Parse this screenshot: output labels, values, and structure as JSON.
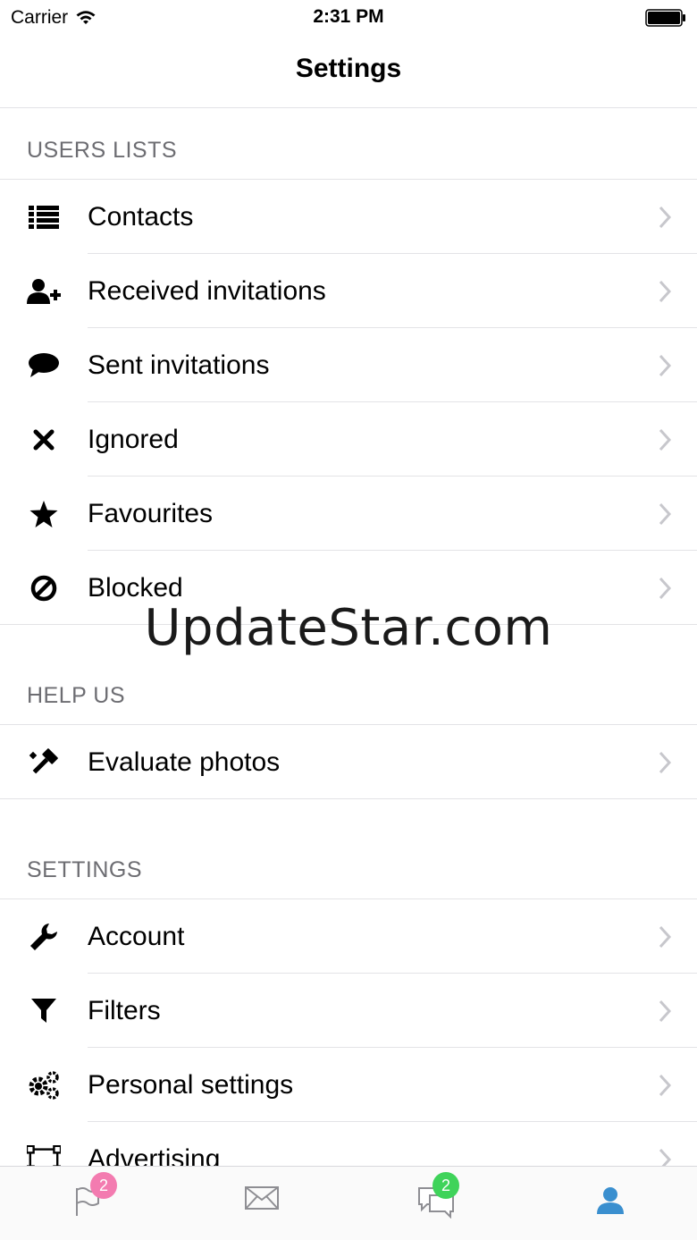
{
  "status_bar": {
    "carrier": "Carrier",
    "time": "2:31 PM"
  },
  "nav": {
    "title": "Settings"
  },
  "sections": {
    "users_lists": {
      "header": "USERS LISTS",
      "items": [
        {
          "label": "Contacts",
          "icon": "list-icon"
        },
        {
          "label": "Received invitations",
          "icon": "user-add-icon"
        },
        {
          "label": "Sent invitations",
          "icon": "speech-bubble-icon"
        },
        {
          "label": "Ignored",
          "icon": "x-mark-icon"
        },
        {
          "label": "Favourites",
          "icon": "star-icon"
        },
        {
          "label": "Blocked",
          "icon": "ban-icon"
        }
      ]
    },
    "help_us": {
      "header": "HELP US",
      "items": [
        {
          "label": "Evaluate photos",
          "icon": "gavel-icon"
        }
      ]
    },
    "settings": {
      "header": "SETTINGS",
      "items": [
        {
          "label": "Account",
          "icon": "wrench-icon"
        },
        {
          "label": "Filters",
          "icon": "filter-icon"
        },
        {
          "label": "Personal settings",
          "icon": "gears-icon"
        },
        {
          "label": "Advertising",
          "icon": "frame-icon"
        }
      ]
    }
  },
  "watermark": "UpdateStar.com",
  "tab_bar": {
    "tabs": [
      {
        "name": "flag",
        "badge": "2",
        "badge_color": "#f37bb0"
      },
      {
        "name": "mail",
        "badge": ""
      },
      {
        "name": "chat",
        "badge": "2",
        "badge_color": "#3fd35a"
      },
      {
        "name": "profile",
        "badge": "",
        "active_color": "#3a8fcf"
      }
    ]
  }
}
